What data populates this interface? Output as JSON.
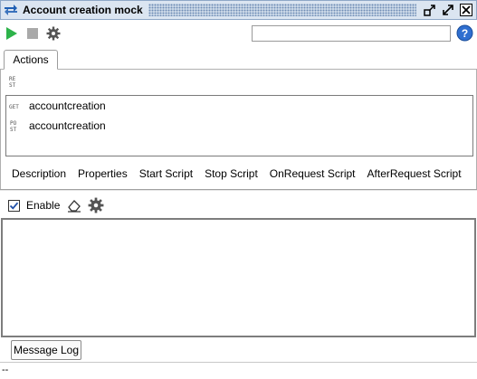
{
  "window": {
    "title": "Account creation mock",
    "icons": [
      "swap-arrows-icon",
      "undock-icon",
      "maximize-icon",
      "close-icon"
    ]
  },
  "toolbar": {
    "icons": [
      "run-icon",
      "stop-icon",
      "gear-icon",
      "help-icon"
    ],
    "search_value": "",
    "accent_run": "#2db34a"
  },
  "tabs": {
    "active": "Actions"
  },
  "actions": {
    "rest_label": "RE ST",
    "items": [
      {
        "method": "GET",
        "label": "accountcreation"
      },
      {
        "method": "POST",
        "label": "accountcreation"
      }
    ]
  },
  "subtabs": [
    "Description",
    "Properties",
    "Start Script",
    "Stop Script",
    "OnRequest Script",
    "AfterRequest Script"
  ],
  "logger": {
    "enable_label": "Enable",
    "enabled": true
  },
  "bottom_button": "Message Log",
  "status": "--"
}
